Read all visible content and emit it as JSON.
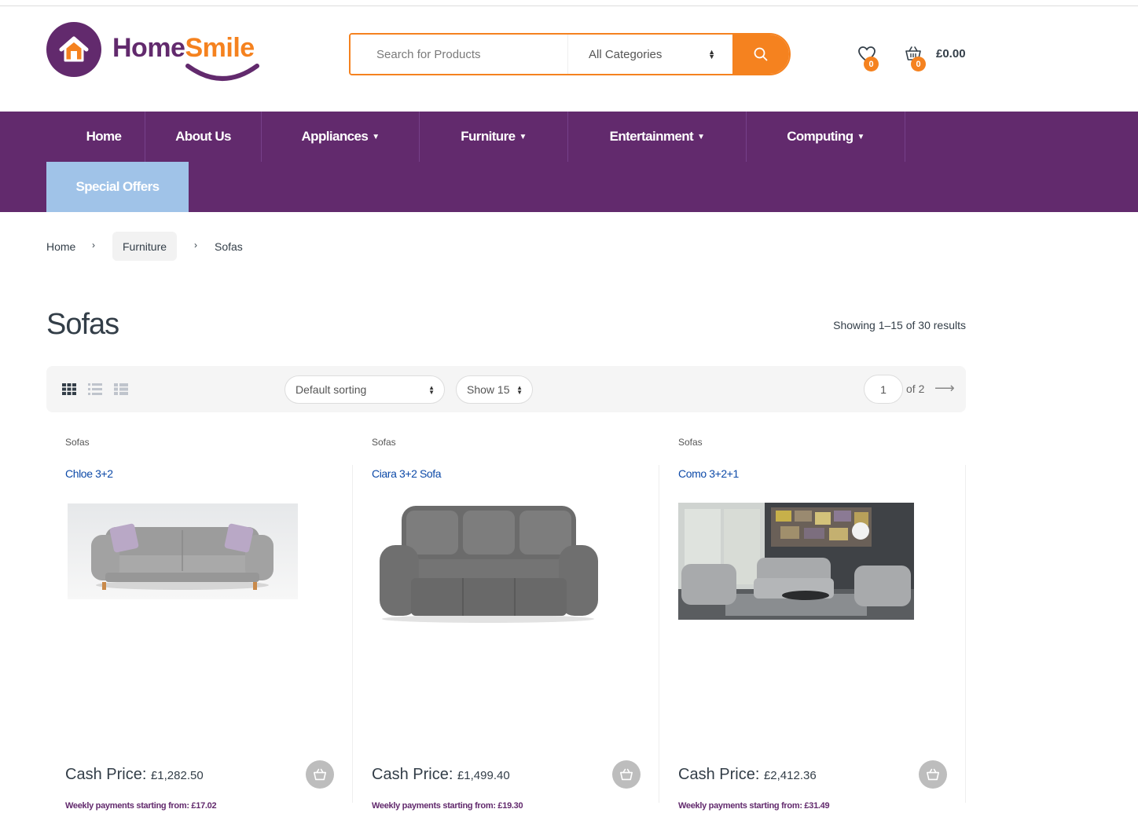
{
  "brand": {
    "name_part1": "Home",
    "name_part2": "Smile",
    "purple": "#622a6d",
    "orange": "#f5821f"
  },
  "search": {
    "placeholder": "Search for Products",
    "category": "All Categories"
  },
  "header": {
    "wishlist_count": "0",
    "cart_count": "0",
    "cart_total": "£0.00"
  },
  "nav": {
    "items": [
      {
        "label": "Home"
      },
      {
        "label": "About Us"
      },
      {
        "label": "Appliances"
      },
      {
        "label": "Furniture"
      },
      {
        "label": "Entertainment"
      },
      {
        "label": "Computing"
      }
    ],
    "special": "Special Offers",
    "special_color": "#a0c3e8"
  },
  "breadcrumb": {
    "items": [
      "Home",
      "Furniture",
      "Sofas"
    ],
    "separator": "›"
  },
  "page": {
    "title": "Sofas",
    "results": "Showing 1–15 of 30 results"
  },
  "toolbar": {
    "sorting": "Default sorting",
    "show": "Show 15",
    "page_value": "1",
    "page_of": "of 2",
    "next": "⟶"
  },
  "products": [
    {
      "category": "Sofas",
      "name": "Chloe 3+2",
      "price_label": "Cash Price:",
      "price": "£1,282.50",
      "weekly": "Weekly payments starting from: £17.02"
    },
    {
      "category": "Sofas",
      "name": "Ciara 3+2 Sofa",
      "price_label": "Cash Price:",
      "price": "£1,499.40",
      "weekly": "Weekly payments starting from: £19.30"
    },
    {
      "category": "Sofas",
      "name": "Como 3+2+1",
      "price_label": "Cash Price:",
      "price": "£2,412.36",
      "weekly": "Weekly payments starting from: £31.49"
    }
  ]
}
